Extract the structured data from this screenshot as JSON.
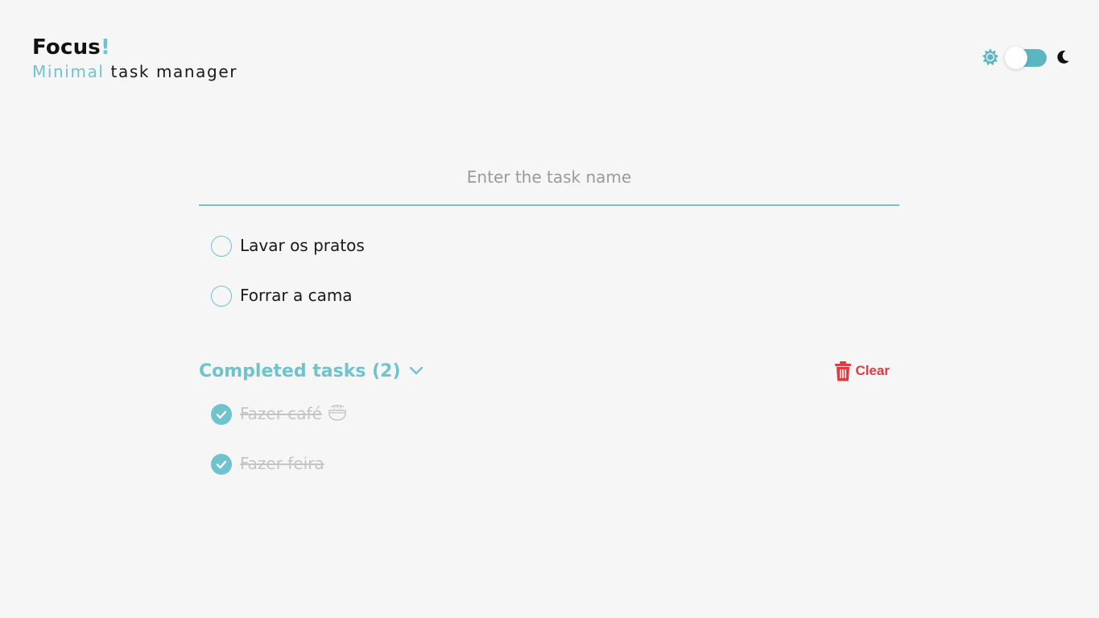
{
  "header": {
    "title": "Focus",
    "title_accent": "!",
    "subtitle_accent": "Minimal",
    "subtitle_rest": "task manager"
  },
  "theme_toggle": {
    "light_icon": "sun-icon",
    "dark_icon": "moon-icon",
    "mode": "light"
  },
  "task_input": {
    "placeholder": "Enter the task name",
    "value": ""
  },
  "pending_tasks": [
    {
      "label": "Lavar os pratos",
      "done": false
    },
    {
      "label": "Forrar a cama",
      "done": false
    }
  ],
  "completed": {
    "title": "Completed tasks (2)",
    "expanded_icon": "chevron-down-icon",
    "clear_label": "Clear",
    "clear_icon": "trash-icon",
    "tasks": [
      {
        "label": "Fazer café",
        "emoji": "coffee-icon",
        "done": true
      },
      {
        "label": "Fazer feira",
        "done": true
      }
    ]
  },
  "colors": {
    "accent": "#6ec3cf",
    "danger": "#e6393f",
    "background": "#f6f6f6",
    "done_text": "#c4c4c4"
  }
}
